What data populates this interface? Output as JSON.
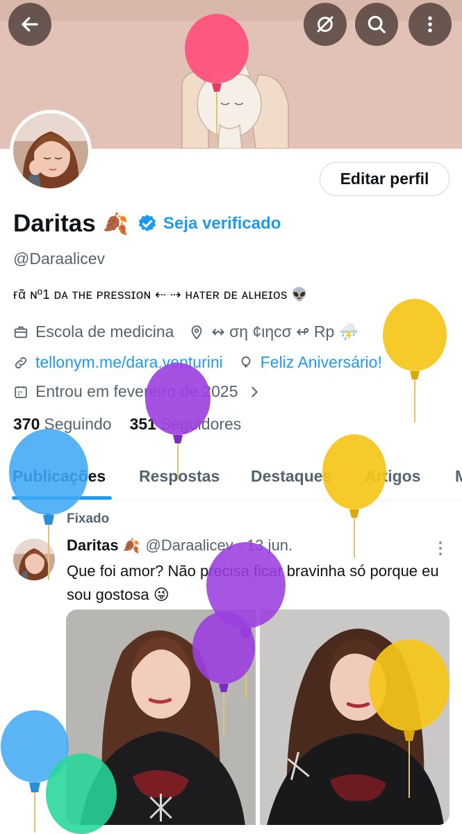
{
  "header": {
    "back_icon": "arrow-left-icon",
    "actions": [
      "no-grok-icon",
      "search-icon",
      "more-vertical-icon"
    ]
  },
  "profile": {
    "edit_button": "Editar perfil",
    "name": "Daritas",
    "name_emoji": "🍂",
    "verify_link": "Seja verificado",
    "handle": "@Daraalicev",
    "bio": "ғᾶ ɴº1 ᴅᴀ ᴛʜᴇ ᴘʀᴇssɪᴏɴ ⇠ ⇢ ʜᴀᴛᴇʀ ᴅᴇ ᴀʟʜᴇɪᴏs 👽",
    "job": "Escola de medicina",
    "location": "↭ ση ¢ιηcσ ↫  Rp ⛈️",
    "website": "tellonym.me/dara.venturini",
    "birthday": "Feliz Aniversário!",
    "joined": "Entrou em fevereiro de 2025",
    "following_count": "370",
    "following_label": "Seguindo",
    "followers_count": "351",
    "followers_label": "Seguidores"
  },
  "tabs": [
    {
      "label": "Publicações",
      "active": true
    },
    {
      "label": "Respostas",
      "active": false
    },
    {
      "label": "Destaques",
      "active": false
    },
    {
      "label": "Artigos",
      "active": false
    },
    {
      "label": "M",
      "active": false
    }
  ],
  "post": {
    "pinned_label": "Fixado",
    "author": "Daritas",
    "author_emoji": "🍂",
    "handle": "@Daraalicev",
    "separator": "·",
    "date": "13 jun.",
    "text": "Que foi amor? Não precisa ficar bravinha só porque eu sou gostosa 😜"
  },
  "colors": {
    "accent": "#1d9bf0",
    "banner": "#e2c1b6",
    "text_primary": "#0f1419",
    "text_secondary": "#536471"
  },
  "balloons": [
    {
      "color": "#ff4f7b",
      "icon": "balloon-pink"
    },
    {
      "color": "#f5c518",
      "icon": "balloon-yellow"
    },
    {
      "color": "#9b3fe0",
      "icon": "balloon-purple"
    },
    {
      "color": "#3fa9f5",
      "icon": "balloon-blue"
    },
    {
      "color": "#27d69a",
      "icon": "balloon-green"
    }
  ]
}
